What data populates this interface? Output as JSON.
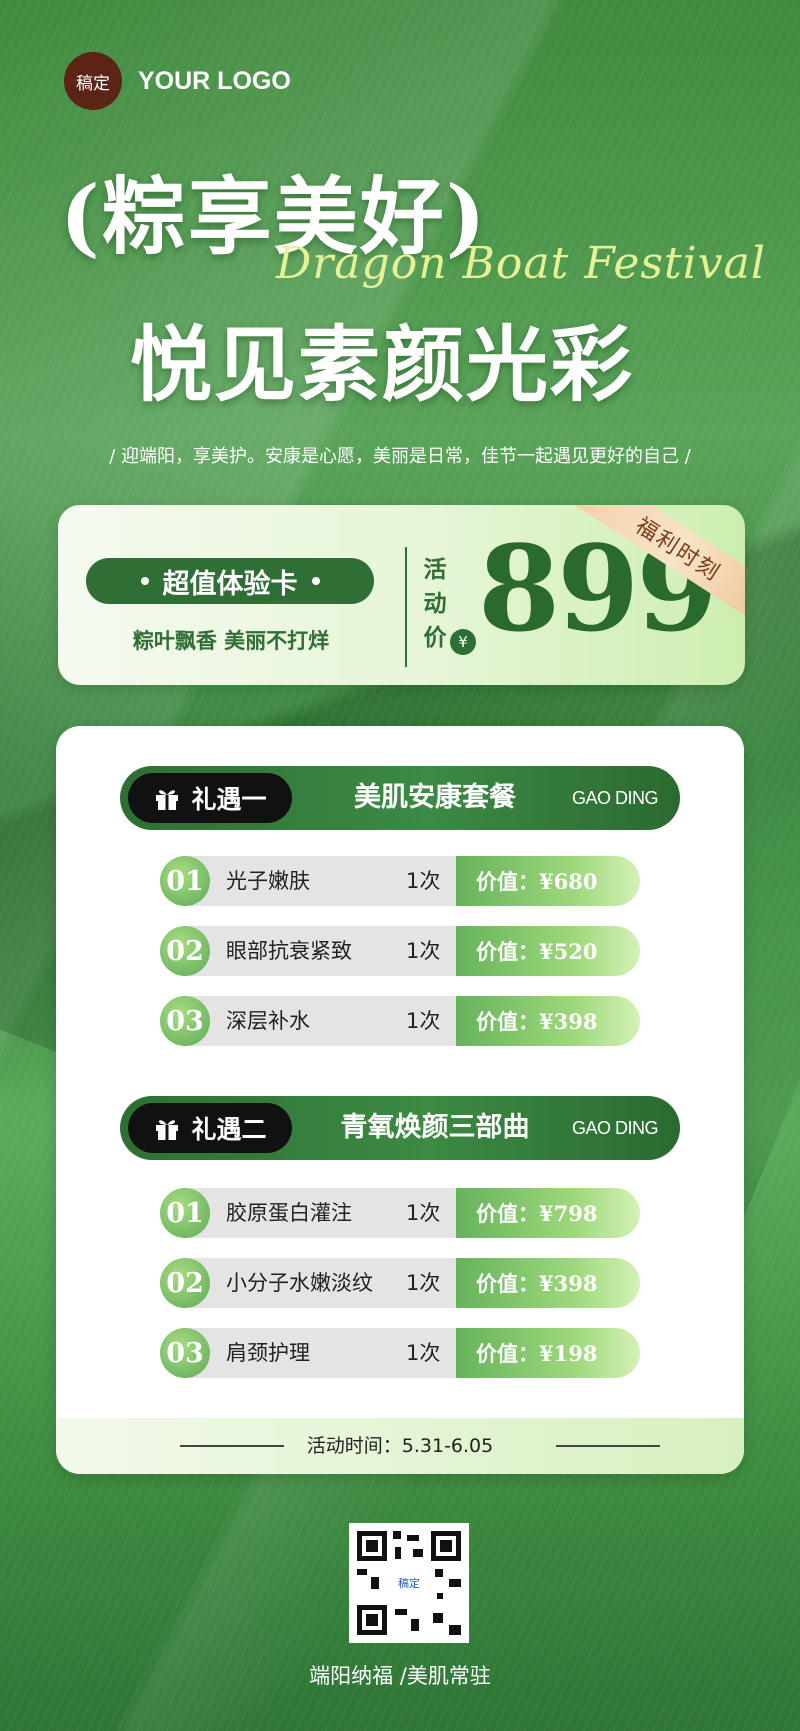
{
  "logo": {
    "badge": "稿定",
    "text": "YOUR LOGO"
  },
  "headline": {
    "line1": "(粽享美好)",
    "script": "Dragon Boat Festival",
    "line2": "悦见素颜光彩"
  },
  "tagline": "/ 迎端阳，享美护。安康是心愿，美丽是日常，佳节一起遇见更好的自己 /",
  "price_card": {
    "pill": "超值体验卡",
    "sub": "粽叶飘香 美丽不打烊",
    "label_chars": [
      "活",
      "动",
      "价"
    ],
    "currency": "¥",
    "price": "899",
    "ribbon": "福利时刻"
  },
  "sections": [
    {
      "tag": "礼遇一",
      "title": "美肌安康套餐",
      "en": "GAO DING",
      "items": [
        {
          "num": "01",
          "name": "光子嫩肤",
          "times": "1次",
          "value": "价值：¥680"
        },
        {
          "num": "02",
          "name": "眼部抗衰紧致",
          "times": "1次",
          "value": "价值：¥520"
        },
        {
          "num": "03",
          "name": "深层补水",
          "times": "1次",
          "value": "价值：¥398"
        }
      ]
    },
    {
      "tag": "礼遇二",
      "title": "青氧焕颜三部曲",
      "en": "GAO DING",
      "items": [
        {
          "num": "01",
          "name": "胶原蛋白灌注",
          "times": "1次",
          "value": "价值：¥798"
        },
        {
          "num": "02",
          "name": "小分子水嫩淡纹",
          "times": "1次",
          "value": "价值：¥398"
        },
        {
          "num": "03",
          "name": "肩颈护理",
          "times": "1次",
          "value": "价值：¥198"
        }
      ]
    }
  ],
  "footer_time": "活动时间：5.31-6.05",
  "qr_label": "稿定",
  "bottom_text": "端阳纳福 /美肌常驻",
  "icons": {
    "gift": "gift-icon",
    "qr": "qr-code-icon"
  },
  "colors": {
    "brand_green": "#2f6e35",
    "logo_brown": "#5b2415",
    "script_yellow": "#e6f296"
  }
}
